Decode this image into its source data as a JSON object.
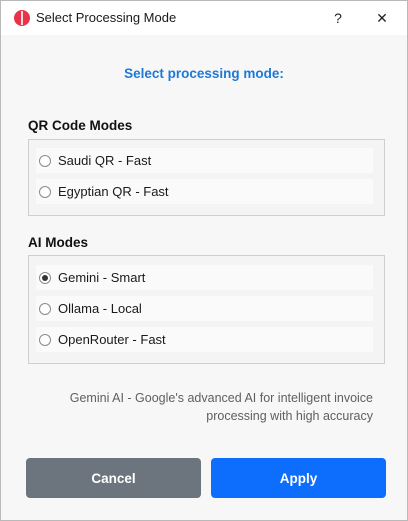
{
  "window": {
    "title": "Select Processing Mode",
    "help_label": "?",
    "close_label": "✕",
    "icon": "app-logo-icon"
  },
  "heading": "Select processing mode:",
  "sections": [
    {
      "title": "QR Code Modes",
      "options": [
        {
          "label": "Saudi QR - Fast",
          "selected": false
        },
        {
          "label": "Egyptian QR - Fast",
          "selected": false
        }
      ]
    },
    {
      "title": "AI Modes",
      "options": [
        {
          "label": "Gemini - Smart",
          "selected": true
        },
        {
          "label": "Ollama - Local",
          "selected": false
        },
        {
          "label": "OpenRouter - Fast",
          "selected": false
        }
      ]
    }
  ],
  "description": "Gemini AI - Google's advanced AI for intelligent invoice processing with high accuracy",
  "buttons": {
    "cancel": "Cancel",
    "apply": "Apply"
  },
  "colors": {
    "heading": "#1e79d6",
    "cancel_bg": "#6c757d",
    "apply_bg": "#0d6efd",
    "icon": "#e8344a"
  }
}
